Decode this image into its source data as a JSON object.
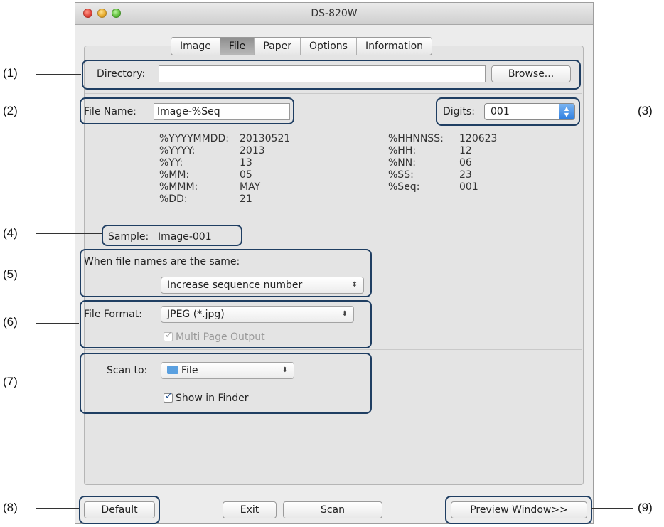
{
  "window": {
    "title": "DS-820W"
  },
  "tabs": [
    {
      "label": "Image",
      "active": false
    },
    {
      "label": "File",
      "active": true
    },
    {
      "label": "Paper",
      "active": false
    },
    {
      "label": "Options",
      "active": false
    },
    {
      "label": "Information",
      "active": false
    }
  ],
  "directory": {
    "label": "Directory:",
    "value": "",
    "browse_label": "Browse..."
  },
  "file_name": {
    "label": "File Name:",
    "value": "Image-%Seq"
  },
  "digits": {
    "label": "Digits:",
    "value": "001"
  },
  "variables_left": [
    {
      "key": "%YYYYMMDD:",
      "value": "20130521"
    },
    {
      "key": "%YYYY:",
      "value": "2013"
    },
    {
      "key": "%YY:",
      "value": "13"
    },
    {
      "key": "%MM:",
      "value": "05"
    },
    {
      "key": "%MMM:",
      "value": "MAY"
    },
    {
      "key": "%DD:",
      "value": "21"
    }
  ],
  "variables_right": [
    {
      "key": "%HHNNSS:",
      "value": "120623"
    },
    {
      "key": "%HH:",
      "value": "12"
    },
    {
      "key": "%NN:",
      "value": "06"
    },
    {
      "key": "%SS:",
      "value": "23"
    },
    {
      "key": "%Seq:",
      "value": "001"
    }
  ],
  "sample": {
    "label": "Sample:",
    "value": "Image-001"
  },
  "same_names": {
    "label": "When file names are the same:",
    "value": "Increase sequence number"
  },
  "file_format": {
    "label": "File Format:",
    "value": "JPEG (*.jpg)",
    "multi_page_label": "Multi Page Output",
    "multi_page_checked": true
  },
  "scan_to": {
    "label": "Scan to:",
    "value": "File",
    "show_in_finder_label": "Show in Finder",
    "show_in_finder_checked": true
  },
  "buttons": {
    "default": "Default",
    "exit": "Exit",
    "scan": "Scan",
    "preview": "Preview Window>>"
  },
  "callouts": [
    "(1)",
    "(2)",
    "(3)",
    "(4)",
    "(5)",
    "(6)",
    "(7)",
    "(8)",
    "(9)"
  ],
  "colors": {
    "highlight": "#1f3e62",
    "accent": "#2f7fe0"
  }
}
